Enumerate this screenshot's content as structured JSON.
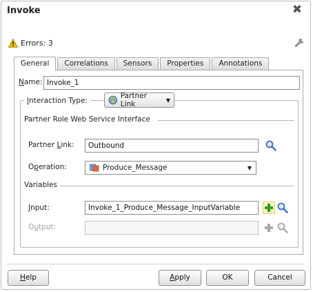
{
  "dialog": {
    "title": "Invoke",
    "errors_label": "Errors: 3"
  },
  "tabs": [
    "General",
    "Correlations",
    "Sensors",
    "Properties",
    "Annotations"
  ],
  "general": {
    "name_label": "Name:",
    "name_value": "Invoke_1",
    "interaction_type_label": "Interaction Type:",
    "interaction_type_value": "Partner Link",
    "partner_role_group": "Partner Role Web Service Interface",
    "partner_link_label": "Partner Link:",
    "partner_link_value": "Outbound",
    "operation_label": "Operation:",
    "operation_value": "Produce_Message",
    "variables_group": "Variables",
    "input_label": "Input:",
    "input_value": "Invoke_1_Produce_Message_InputVariable",
    "output_label": "Output:",
    "output_value": ""
  },
  "footer": {
    "help": "Help",
    "apply": "Apply",
    "ok": "OK",
    "cancel": "Cancel"
  },
  "colors": {
    "warning": "#f2c200",
    "add_green": "#2e9c2e",
    "search_blue": "#3a6fbf",
    "operation_icon": "#d9531e"
  },
  "icons": [
    "close-icon",
    "warning-icon",
    "wrench-icon",
    "partner-link-icon",
    "search-icon",
    "operation-icon",
    "add-icon"
  ]
}
